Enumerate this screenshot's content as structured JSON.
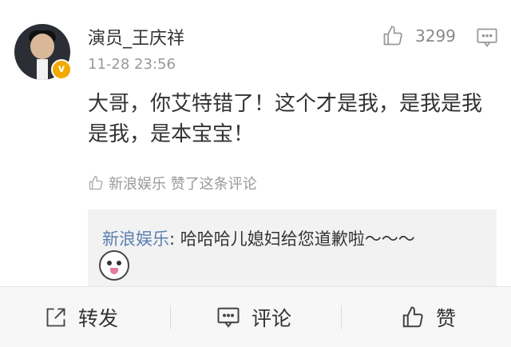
{
  "post": {
    "username": "演员_王庆祥",
    "timestamp": "11-28 23:56",
    "verified_badge": "v",
    "like_count": "3299",
    "body": "大哥，你艾特错了！这个才是我，是我是我是我，是本宝宝！"
  },
  "liked_by": {
    "text": "新浪娱乐 赞了这条评论"
  },
  "reply": {
    "user": "新浪娱乐",
    "text": ": 哈哈哈儿媳妇给您道歉啦～～～"
  },
  "footer": {
    "repost_label": "转发",
    "comment_label": "评论",
    "like_label": "赞"
  },
  "colors": {
    "link": "#5b7fb0",
    "badge": "#f2a900",
    "muted": "#999999"
  }
}
